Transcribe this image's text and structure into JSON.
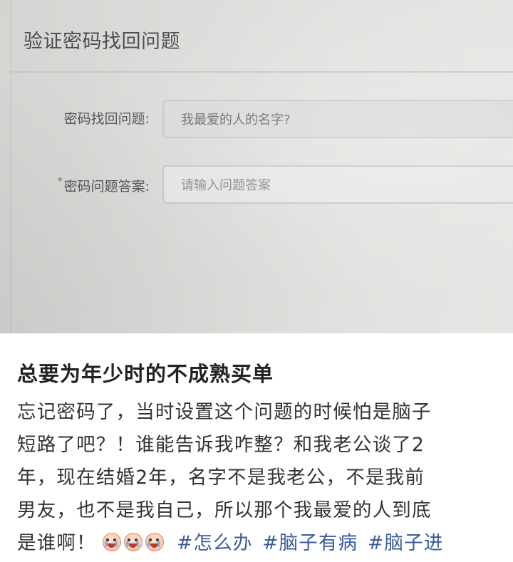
{
  "dialog": {
    "title": "验证密码找回问题",
    "question_label": "密码找回问题:",
    "question_value": "我最爱的人的名字?",
    "answer_label": "密码问题答案:",
    "answer_required_mark": "*",
    "answer_placeholder": "请输入问题答案"
  },
  "post": {
    "title": "总要为年少时的不成熟买单",
    "lines": [
      "忘记密码了，当时设置这个问题的时候怕是脑子",
      "短路了吧？！谁能告诉我咋整？和我老公谈了2",
      "年，现在结婚2年，名字不是我老公，不是我前",
      "男友，也不是我自己，所以那个我最爱的人到底",
      "是谁啊！"
    ],
    "emoji_icons": [
      "crying-face-icon",
      "crying-face-icon",
      "crying-face-icon"
    ],
    "hashtags": [
      "#怎么办",
      "#脑子有病",
      "#脑子进"
    ],
    "hashtag_color": "#3b5b9a"
  }
}
